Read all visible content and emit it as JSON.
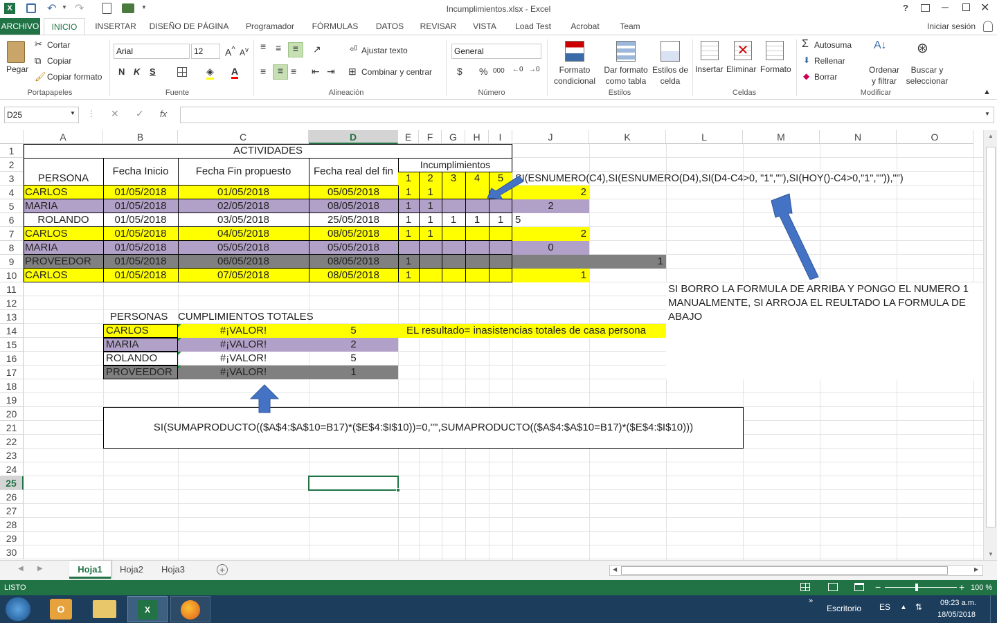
{
  "window": {
    "title": "Incumplimientos.xlsx - Excel",
    "help": "?",
    "sign_in": "Iniciar sesión"
  },
  "tabs": [
    "ARCHIVO",
    "INICIO",
    "INSERTAR",
    "DISEÑO DE PÁGINA",
    "Programador",
    "FÓRMULAS",
    "DATOS",
    "REVISAR",
    "VISTA",
    "Load Test",
    "Acrobat",
    "Team"
  ],
  "ribbon": {
    "clipboard": {
      "paste": "Pegar",
      "cut": "Cortar",
      "copy": "Copiar",
      "format_painter": "Copiar formato",
      "group": "Portapapeles"
    },
    "font": {
      "name": "Arial",
      "size": "12",
      "bold": "N",
      "italic": "K",
      "underline": "S",
      "group": "Fuente"
    },
    "alignment": {
      "wrap": "Ajustar texto",
      "merge": "Combinar y centrar",
      "group": "Alineación"
    },
    "number": {
      "format": "General",
      "currency": "$",
      "percent": "%",
      "thousands": "000",
      "group": "Número"
    },
    "styles": {
      "conditional": "Formato condicional",
      "table": "Dar formato como tabla",
      "cell_styles": "Estilos de celda",
      "group": "Estilos"
    },
    "cells": {
      "insert": "Insertar",
      "delete": "Eliminar",
      "format": "Formato",
      "group": "Celdas"
    },
    "editing": {
      "autosum": "Autosuma",
      "fill": "Rellenar",
      "clear": "Borrar",
      "sort": "Ordenar y filtrar",
      "find": "Buscar y seleccionar",
      "group": "Modificar"
    }
  },
  "formula_bar": {
    "name_box": "D25",
    "formula": "",
    "fx": "fx"
  },
  "columns": [
    "A",
    "B",
    "C",
    "D",
    "E",
    "F",
    "G",
    "H",
    "I",
    "J",
    "K",
    "L",
    "M",
    "N",
    "O"
  ],
  "rows": [
    "1",
    "2",
    "3",
    "4",
    "5",
    "6",
    "7",
    "8",
    "9",
    "10",
    "11",
    "12",
    "13",
    "14",
    "15",
    "16",
    "17",
    "18",
    "19",
    "20",
    "21",
    "22",
    "23",
    "24",
    "25",
    "26",
    "27",
    "28",
    "29",
    "30"
  ],
  "sheet": {
    "title": "ACTIVIDADES",
    "headers": {
      "persona": "PERSONA",
      "fecha_inicio": "Fecha Inicio",
      "fecha_fin": "Fecha Fin propuesto",
      "fecha_real": "Fecha real del fin",
      "incumplimientos": "Incumplimientos",
      "nums": [
        "1",
        "2",
        "3",
        "4",
        "5"
      ]
    },
    "formula_note": "SI(ESNUMERO(C4),SI(ESNUMERO(D4),SI(D4-C4>0, \"1\",\"\"),SI(HOY()-C4>0,\"1\",\"\")),\"\")",
    "data": [
      {
        "persona": "CARLOS",
        "ini": "01/05/2018",
        "fin": "01/05/2018",
        "real": "05/05/2018",
        "e": "1",
        "f": "1",
        "g": "",
        "h": "",
        "i": "",
        "j": "2",
        "k": "",
        "color": "#ffff00"
      },
      {
        "persona": "MARIA",
        "ini": "01/05/2018",
        "fin": "02/05/2018",
        "real": "08/05/2018",
        "e": "1",
        "f": "1",
        "g": "",
        "h": "",
        "i": "",
        "j": "2",
        "k": "",
        "color": "#b1a0c7"
      },
      {
        "persona": "ROLANDO",
        "ini": "01/05/2018",
        "fin": "03/05/2018",
        "real": "25/05/2018",
        "e": "1",
        "f": "1",
        "g": "1",
        "h": "1",
        "i": "1",
        "j": "5",
        "k": "",
        "color": "#ffffff"
      },
      {
        "persona": "CARLOS",
        "ini": "01/05/2018",
        "fin": "04/05/2018",
        "real": "08/05/2018",
        "e": "1",
        "f": "1",
        "g": "",
        "h": "",
        "i": "",
        "j": "2",
        "k": "",
        "color": "#ffff00"
      },
      {
        "persona": "MARIA",
        "ini": "01/05/2018",
        "fin": "05/05/2018",
        "real": "05/05/2018",
        "e": "",
        "f": "",
        "g": "",
        "h": "",
        "i": "",
        "j": "0",
        "k": "",
        "color": "#b1a0c7"
      },
      {
        "persona": "PROVEEDOR",
        "ini": "01/05/2018",
        "fin": "06/05/2018",
        "real": "08/05/2018",
        "e": "1",
        "f": "",
        "g": "",
        "h": "",
        "i": "",
        "j": "",
        "k": "1",
        "color": "#808080"
      },
      {
        "persona": "CARLOS",
        "ini": "01/05/2018",
        "fin": "07/05/2018",
        "real": "08/05/2018",
        "e": "1",
        "f": "",
        "g": "",
        "h": "",
        "i": "",
        "j": "1",
        "k": "",
        "color": "#ffff00"
      }
    ],
    "note_right": "SI BORRO LA FORMULA DE ARRIBA Y PONGO EL NUMERO 1 MANUALMENTE, SI ARROJA EL REULTADO LA FORMULA DE ABAJO",
    "summary_headers": {
      "personas": "PERSONAS",
      "cumplimientos": "CUMPLIMIENTOS TOTALES"
    },
    "summary": [
      {
        "persona": "CARLOS",
        "valor": "#¡VALOR!",
        "total": "5",
        "color": "#ffff00"
      },
      {
        "persona": "MARIA",
        "valor": "#¡VALOR!",
        "total": "2",
        "color": "#b1a0c7"
      },
      {
        "persona": "ROLANDO",
        "valor": "#¡VALOR!",
        "total": "5",
        "color": "#ffffff"
      },
      {
        "persona": "PROVEEDOR",
        "valor": "#¡VALOR!",
        "total": "1",
        "color": "#808080"
      }
    ],
    "result_note": "EL resultado= inasistencias totales de casa persona",
    "formula_box": "SI(SUMAPRODUCTO(($A$4:$A$10=B17)*($E$4:$I$10))=0,\"\",SUMAPRODUCTO(($A$4:$A$10=B17)*($E$4:$I$10)))"
  },
  "sheets": [
    "Hoja1",
    "Hoja2",
    "Hoja3"
  ],
  "status": {
    "ready": "LISTO",
    "zoom": "100 %"
  },
  "taskbar": {
    "desktop": "Escritorio",
    "lang": "ES",
    "time": "09:23 a.m.",
    "date": "18/05/2018"
  }
}
